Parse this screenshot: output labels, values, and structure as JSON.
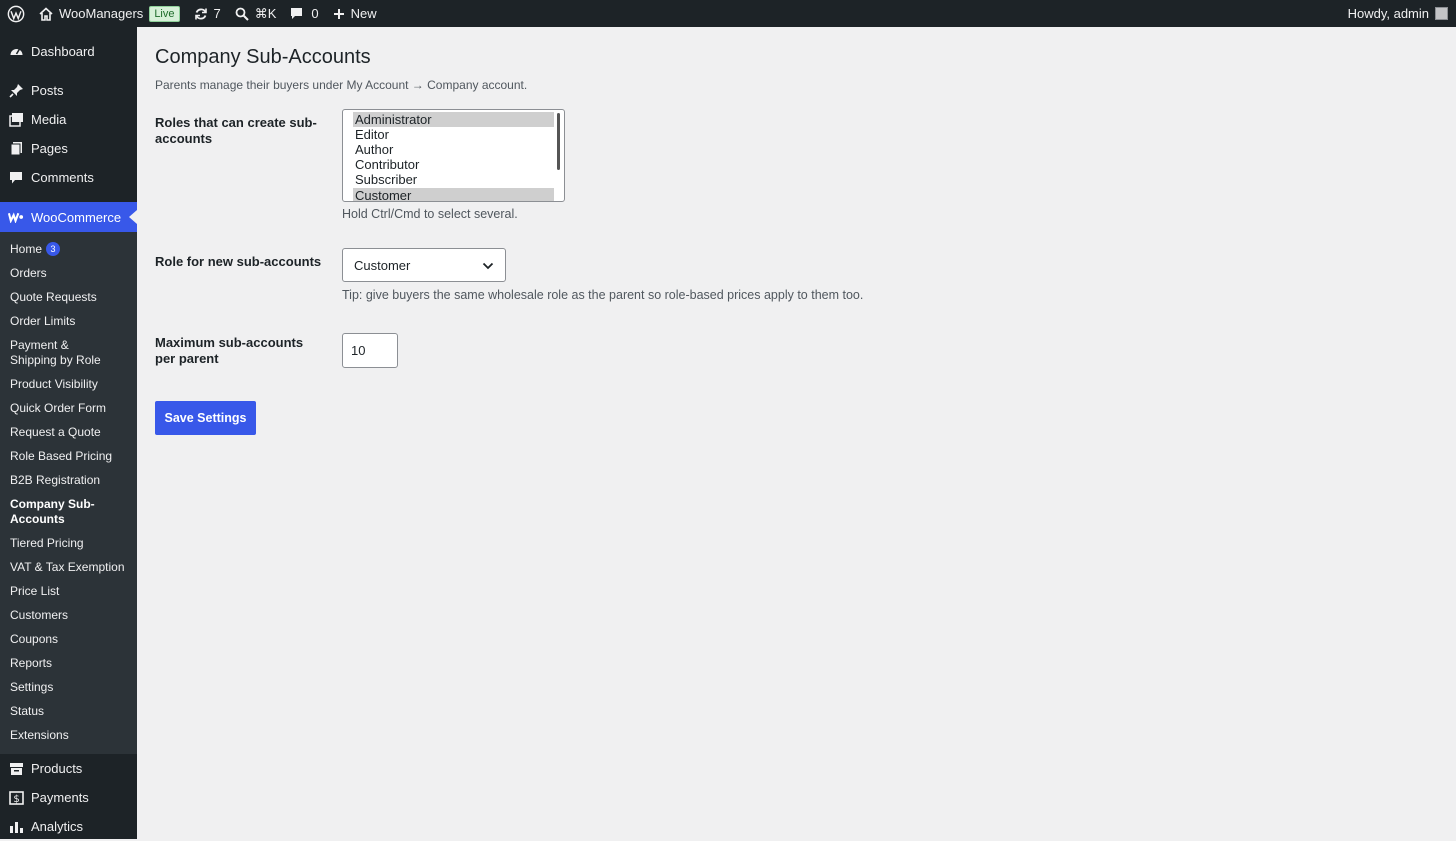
{
  "adminbar": {
    "site_name": "WooManagers",
    "live_badge": "Live",
    "updates_count": "7",
    "search_shortcut": "⌘K",
    "comments_count": "0",
    "new_label": "New",
    "greeting": "Howdy, admin"
  },
  "sidebar": {
    "top_items": [
      {
        "label": "Dashboard",
        "icon": "dashboard-icon"
      },
      {
        "label": "Posts",
        "icon": "pin-icon"
      },
      {
        "label": "Media",
        "icon": "media-icon"
      },
      {
        "label": "Pages",
        "icon": "pages-icon"
      },
      {
        "label": "Comments",
        "icon": "comment-icon"
      }
    ],
    "woocommerce": {
      "label": "WooCommerce",
      "icon": "woo-icon"
    },
    "submenu": [
      {
        "label": "Home",
        "badge": "3"
      },
      {
        "label": "Orders"
      },
      {
        "label": "Quote Requests"
      },
      {
        "label": "Order Limits"
      },
      {
        "label": "Payment & Shipping by Role"
      },
      {
        "label": "Product Visibility"
      },
      {
        "label": "Quick Order Form"
      },
      {
        "label": "Request a Quote"
      },
      {
        "label": "Role Based Pricing"
      },
      {
        "label": "B2B Registration"
      },
      {
        "label": "Company Sub-Accounts",
        "current": true
      },
      {
        "label": "Tiered Pricing"
      },
      {
        "label": "VAT & Tax Exemption"
      },
      {
        "label": "Price List"
      },
      {
        "label": "Customers"
      },
      {
        "label": "Coupons"
      },
      {
        "label": "Reports"
      },
      {
        "label": "Settings"
      },
      {
        "label": "Status"
      },
      {
        "label": "Extensions"
      }
    ],
    "bottom_items": [
      {
        "label": "Products",
        "icon": "products-icon"
      },
      {
        "label": "Payments",
        "icon": "payments-icon"
      },
      {
        "label": "Analytics",
        "icon": "analytics-icon"
      }
    ]
  },
  "main": {
    "title": "Company Sub-Accounts",
    "description": "Parents manage their buyers under My Account → Company account.",
    "roles_field": {
      "label": "Roles that can create sub-accounts",
      "options": [
        {
          "label": "Administrator",
          "selected": true
        },
        {
          "label": "Editor",
          "selected": false
        },
        {
          "label": "Author",
          "selected": false
        },
        {
          "label": "Contributor",
          "selected": false
        },
        {
          "label": "Subscriber",
          "selected": false
        },
        {
          "label": "Customer",
          "selected": true
        }
      ],
      "help": "Hold Ctrl/Cmd to select several."
    },
    "new_role_field": {
      "label": "Role for new sub-accounts",
      "value": "Customer",
      "help": "Tip: give buyers the same wholesale role as the parent so role-based prices apply to them too."
    },
    "max_field": {
      "label": "Maximum sub-accounts per parent",
      "value": "10"
    },
    "save_label": "Save Settings"
  },
  "colors": {
    "admin_dark": "#1d2327",
    "submenu_bg": "#2c3338",
    "accent": "#3858e9",
    "page_bg": "#f0f0f1"
  }
}
